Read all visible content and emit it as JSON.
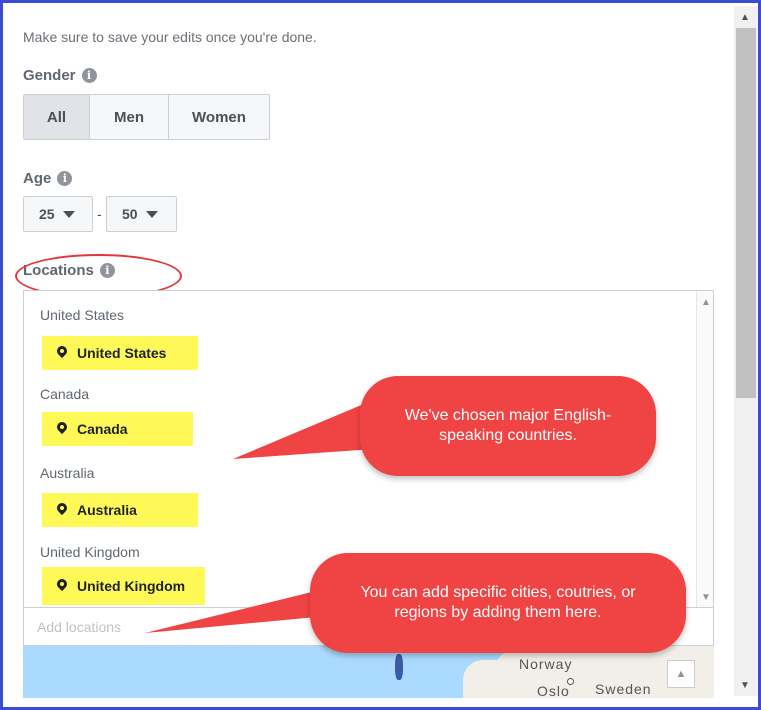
{
  "intro_text": "Make sure to save your edits once you're done.",
  "gender": {
    "label": "Gender",
    "info_glyph": "i",
    "options": [
      "All",
      "Men",
      "Women"
    ],
    "selected": "All"
  },
  "age": {
    "label": "Age",
    "info_glyph": "i",
    "min": "25",
    "separator": "-",
    "max": "50"
  },
  "locations": {
    "label": "Locations",
    "info_glyph": "i",
    "groups": [
      {
        "heading": "United States",
        "pill": "United States"
      },
      {
        "heading": "Canada",
        "pill": "Canada"
      },
      {
        "heading": "Australia",
        "pill": "Australia"
      },
      {
        "heading": "United Kingdom",
        "pill": "United Kingdom"
      }
    ],
    "add_placeholder": "Add locations",
    "highlight_color": "#fff957",
    "scroll_up_glyph": "▲",
    "scroll_down_glyph": "▼"
  },
  "map": {
    "labels": [
      "Norway",
      "Oslo",
      "Sweden"
    ],
    "control_glyph": "▲"
  },
  "callouts": [
    "We've chosen major English-speaking countries.",
    "You can add specific cities, coutries, or regions by adding them here."
  ],
  "colors": {
    "callout": "#f04344",
    "annotation_circle": "#e0383c",
    "frame_border": "#3b4bd6"
  }
}
